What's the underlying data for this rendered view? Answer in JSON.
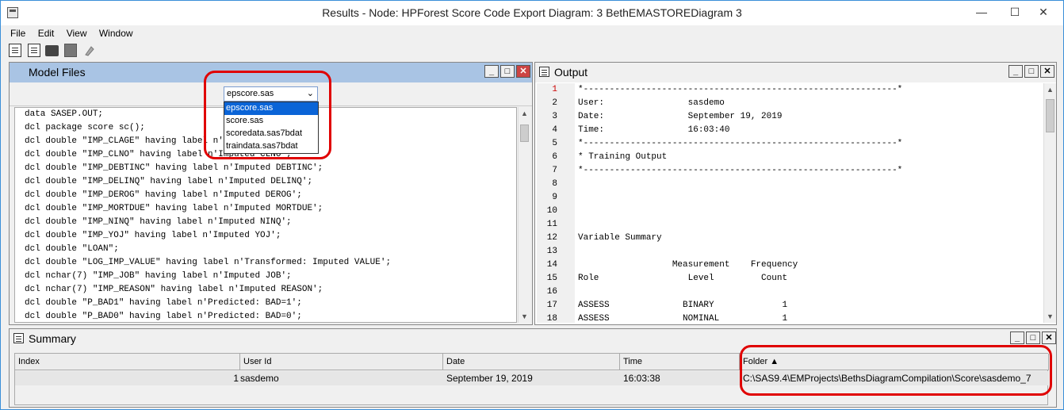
{
  "window": {
    "title": "Results - Node: HPForest Score Code Export  Diagram: 3 BethEMASTOREDiagram 3",
    "controls": {
      "minimize": "—",
      "maximize": "☐",
      "close": "✕"
    }
  },
  "menu": [
    "File",
    "Edit",
    "View",
    "Window"
  ],
  "toolbar": [
    "new-document-icon",
    "document-icon",
    "printer-icon",
    "gray-box-icon",
    "properties-icon"
  ],
  "model_files": {
    "title": "Model Files",
    "selected_file": "epscore.sas",
    "file_options": [
      "epscore.sas",
      "score.sas",
      "scoredata.sas7bdat",
      "traindata.sas7bdat"
    ],
    "code_lines": [
      "data SASEP.OUT;",
      "dcl package score sc();",
      "dcl double \"IMP_CLAGE\" having label n'Imputed CLAGE';",
      "dcl double \"IMP_CLNO\" having label n'Imputed CLNO';",
      "dcl double \"IMP_DEBTINC\" having label n'Imputed DEBTINC';",
      "dcl double \"IMP_DELINQ\" having label n'Imputed DELINQ';",
      "dcl double \"IMP_DEROG\" having label n'Imputed DEROG';",
      "dcl double \"IMP_MORTDUE\" having label n'Imputed MORTDUE';",
      "dcl double \"IMP_NINQ\" having label n'Imputed NINQ';",
      "dcl double \"IMP_YOJ\" having label n'Imputed YOJ';",
      "dcl double \"LOAN\";",
      "dcl double \"LOG_IMP_VALUE\" having label n'Transformed: Imputed VALUE';",
      "dcl nchar(7) \"IMP_JOB\" having label n'Imputed JOB';",
      "dcl nchar(7) \"IMP_REASON\" having label n'Imputed REASON';",
      "dcl double \"P_BAD1\" having label n'Predicted: BAD=1';",
      "dcl double \"P_BAD0\" having label n'Predicted: BAD=0';"
    ]
  },
  "output": {
    "title": "Output",
    "line_numbers": [
      "1",
      "2",
      "3",
      "4",
      "5",
      "6",
      "7",
      "8",
      "9",
      "10",
      "11",
      "12",
      "13",
      "14",
      "15",
      "16",
      "17",
      "18"
    ],
    "lines": [
      "*------------------------------------------------------------*",
      "User:                sasdemo",
      "Date:                September 19, 2019",
      "Time:                16:03:40",
      "*------------------------------------------------------------*",
      "* Training Output",
      "*------------------------------------------------------------*",
      "",
      "",
      "",
      "",
      "Variable Summary",
      "",
      "                  Measurement    Frequency",
      "Role                 Level         Count",
      "",
      "ASSESS              BINARY             1",
      "ASSESS              NOMINAL            1"
    ]
  },
  "summary": {
    "title": "Summary",
    "columns": [
      "Index",
      "User Id",
      "Date",
      "Time",
      "Folder ▲"
    ],
    "row": {
      "index": "1",
      "user_id": "sasdemo",
      "date": "September 19, 2019",
      "time": "16:03:38",
      "folder": "C:\\SAS9.4\\EMProjects\\BethsDiagramCompilation\\Score\\sasdemo_7"
    }
  },
  "colors": {
    "panel_header_active": "#a9c4e4",
    "highlight": "#e00000",
    "selection": "#0a64d7"
  }
}
